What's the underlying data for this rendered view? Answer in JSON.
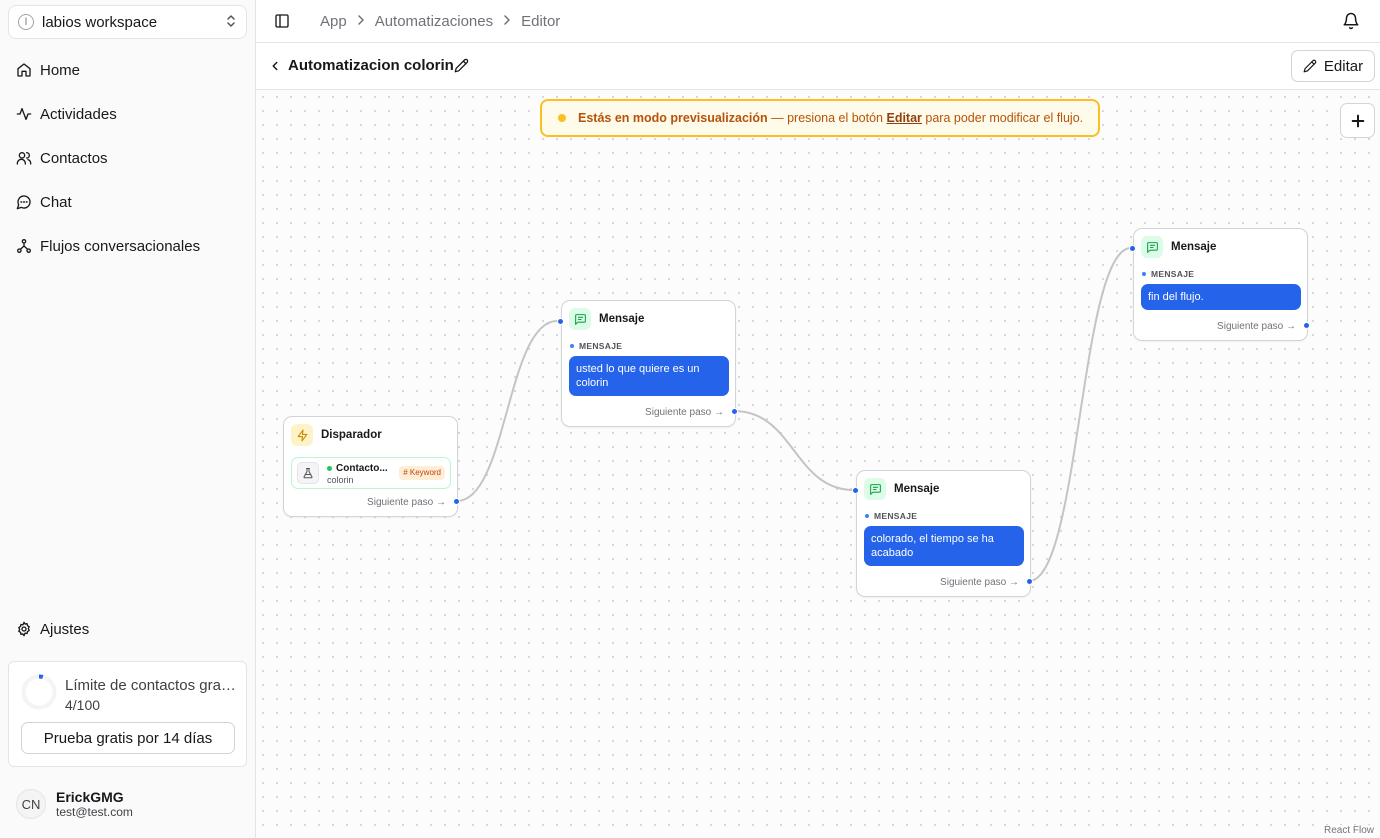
{
  "workspace": {
    "initial": "l",
    "name": "labios workspace"
  },
  "nav": {
    "items": [
      {
        "label": "Home",
        "icon": "home-icon"
      },
      {
        "label": "Actividades",
        "icon": "activity-icon"
      },
      {
        "label": "Contactos",
        "icon": "users-icon"
      },
      {
        "label": "Chat",
        "icon": "chat-icon"
      },
      {
        "label": "Flujos conversacionales",
        "icon": "workflow-icon"
      }
    ],
    "settings": "Ajustes"
  },
  "limit": {
    "title": "Límite de contactos gratuitos",
    "count": "4/100",
    "used": 4,
    "max": 100,
    "trial_button": "Prueba gratis por 14 días"
  },
  "user": {
    "initials": "CN",
    "name": "ErickGMG",
    "email": "test@test.com"
  },
  "breadcrumb": [
    "App",
    "Automatizaciones",
    "Editor"
  ],
  "flow": {
    "title": "Automatizacion colorin",
    "edit_label": "Editar"
  },
  "banner": {
    "strong": "Estás en modo previsualización",
    "middle": " — presiona el botón ",
    "link": "Editar",
    "end": " para poder modificar el flujo."
  },
  "nodes": {
    "trigger": {
      "title": "Disparador",
      "card_title": "Contacto...",
      "card_sub": "colorin",
      "badge": "# Keyword",
      "next": "Siguiente paso →"
    },
    "msg1": {
      "title": "Mensaje",
      "label": "MENSAJE",
      "text": "usted lo que quiere es un colorin",
      "next": "Siguiente paso →"
    },
    "msg2": {
      "title": "Mensaje",
      "label": "MENSAJE",
      "text": "colorado, el tiempo se ha acabado",
      "next": "Siguiente paso →"
    },
    "msg3": {
      "title": "Mensaje",
      "label": "MENSAJE",
      "text": "fin del flujo.",
      "next": "Siguiente paso →"
    }
  },
  "attribution": "React Flow",
  "colors": {
    "accent": "#2563eb",
    "warning": "#fbbf24",
    "message_icon_bg": "#dcfce7",
    "trigger_icon_bg": "#fef3c7"
  }
}
